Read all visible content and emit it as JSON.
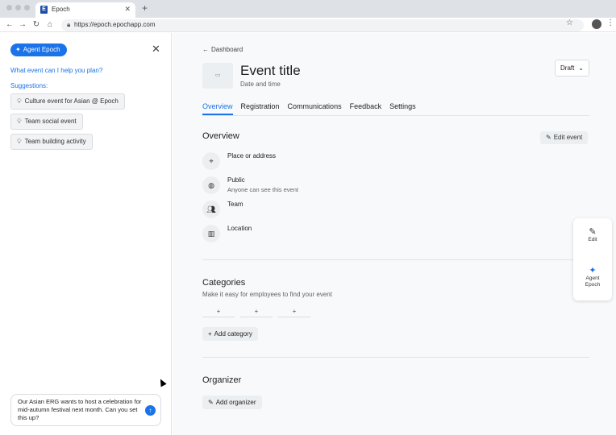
{
  "browser": {
    "tab_title": "Epoch",
    "tab_favicon": "E",
    "url": "https://epoch.epochapp.com"
  },
  "left_panel": {
    "agent_button_label": "Agent Epoch",
    "question": "What event can I help you plan?",
    "suggestions_label": "Suggestions:",
    "suggestions": [
      "Culture event for Asian @ Epoch",
      "Team social event",
      "Team building activity"
    ],
    "chat_input_value": "Our Asian ERG wants to host a celebration for mid-autumn festival next month. Can you set this up?"
  },
  "main": {
    "back_link": "Dashboard",
    "event_title": "Event title",
    "event_subtitle": "Date and time",
    "status_dropdown": "Draft",
    "tabs": [
      "Overview",
      "Registration",
      "Communications",
      "Feedback",
      "Settings"
    ],
    "active_tab": "Overview",
    "overview": {
      "title": "Overview",
      "edit_button": "Edit event",
      "rows": [
        {
          "icon": "location-pin-icon",
          "label": "Place or address",
          "sub": ""
        },
        {
          "icon": "globe-icon",
          "label": "Public",
          "sub": "Anyone can see this event"
        },
        {
          "icon": "team-icon",
          "label": "Team",
          "sub": ""
        },
        {
          "icon": "building-icon",
          "label": "Location",
          "sub": ""
        }
      ]
    },
    "categories": {
      "title": "Categories",
      "subtitle": "Make it easy for employees to find your event",
      "slot_glyph": "+",
      "add_button": "Add category"
    },
    "organizer": {
      "title": "Organizer",
      "add_button": "Add organizer"
    },
    "side_actions": [
      {
        "icon": "pencil-icon",
        "label": "Edit"
      },
      {
        "icon": "sparkle-icon",
        "label": "Agent Epoch"
      }
    ]
  },
  "colors": {
    "accent": "#1a73e8",
    "panel_bg": "#f8f9fa"
  }
}
